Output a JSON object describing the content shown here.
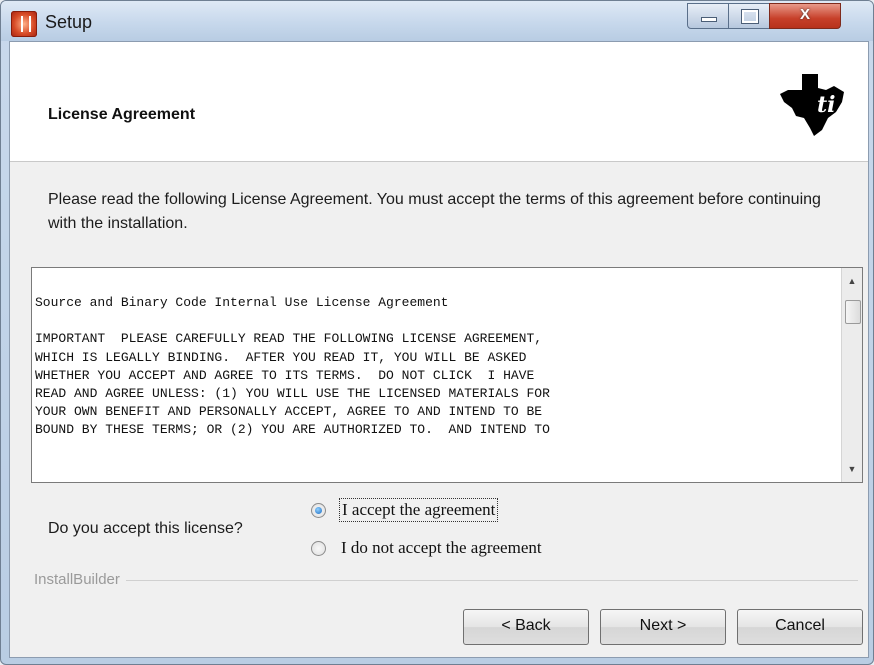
{
  "window": {
    "title": "Setup"
  },
  "header": {
    "title": "License Agreement",
    "logo": "texas-instruments-logo"
  },
  "intro": {
    "text": "Please read the following License Agreement. You must accept the terms of this agreement before continuing with the installation."
  },
  "license": {
    "lines": [
      "Source and Binary Code Internal Use License Agreement",
      "",
      "IMPORTANT  PLEASE CAREFULLY READ THE FOLLOWING LICENSE AGREEMENT,",
      "WHICH IS LEGALLY BINDING.  AFTER YOU READ IT, YOU WILL BE ASKED",
      "WHETHER YOU ACCEPT AND AGREE TO ITS TERMS.  DO NOT CLICK  I HAVE",
      "READ AND AGREE UNLESS: (1) YOU WILL USE THE LICENSED MATERIALS FOR",
      "YOUR OWN BENEFIT AND PERSONALLY ACCEPT, AGREE TO AND INTEND TO BE",
      "BOUND BY THESE TERMS; OR (2) YOU ARE AUTHORIZED TO.  AND INTEND TO"
    ]
  },
  "accept": {
    "question": "Do you accept this license?",
    "options": [
      {
        "label": "I accept the agreement",
        "checked": true
      },
      {
        "label": "I do not accept the agreement",
        "checked": false
      }
    ]
  },
  "footer": {
    "group_label": "InstallBuilder"
  },
  "buttons": {
    "back": "< Back",
    "next": "Next >",
    "cancel": "Cancel"
  },
  "colors": {
    "close_button": "#c7402a",
    "radio_selected": "#1d6bc0"
  }
}
